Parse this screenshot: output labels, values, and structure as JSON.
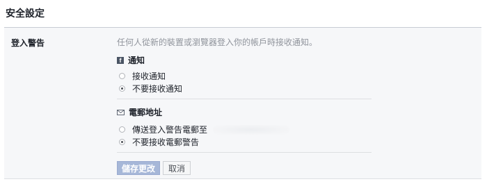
{
  "page_title": "安全設定",
  "section": {
    "label": "登入警告",
    "description": "任何人從新的裝置或瀏覽器登入你的帳戶時接收通知。"
  },
  "notifications": {
    "heading": "通知",
    "icon": "facebook-icon",
    "options": [
      {
        "label": "接收通知",
        "checked": false
      },
      {
        "label": "不要接收通知",
        "checked": true
      }
    ]
  },
  "email": {
    "heading": "電郵地址",
    "icon": "envelope-icon",
    "options": [
      {
        "label": "傳送登入警告電郵至",
        "checked": false
      },
      {
        "label": "不要接收電郵警告",
        "checked": true
      }
    ]
  },
  "buttons": {
    "save": "儲存更改",
    "cancel": "取消"
  }
}
